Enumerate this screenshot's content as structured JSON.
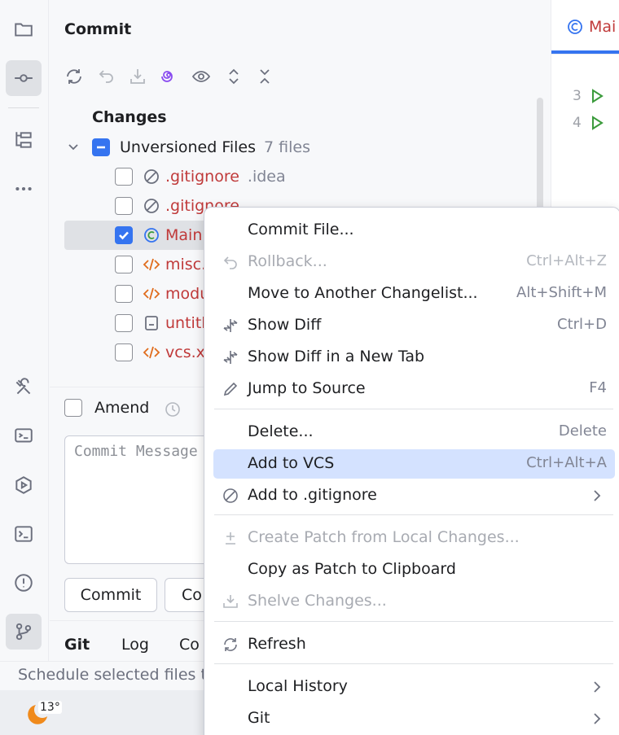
{
  "panel": {
    "title": "Commit",
    "changes_heading": "Changes",
    "group": {
      "label": "Unversioned Files",
      "count": "7 files"
    },
    "files": [
      {
        "name": ".gitignore",
        "note": ".idea",
        "icon": "ignored-icon",
        "checked": false
      },
      {
        "name": ".gitignore",
        "note": "",
        "icon": "ignored-icon",
        "checked": false
      },
      {
        "name": "Main.",
        "note": "",
        "icon": "java-class-icon",
        "checked": true
      },
      {
        "name": "misc.",
        "note": "",
        "icon": "xml-icon",
        "checked": false
      },
      {
        "name": "modu",
        "note": "",
        "icon": "xml-icon",
        "checked": false
      },
      {
        "name": "untitl",
        "note": "",
        "icon": "text-file-icon",
        "checked": false
      },
      {
        "name": "vcs.x",
        "note": "",
        "icon": "xml-icon",
        "checked": false
      }
    ],
    "amend_label": "Amend",
    "message_placeholder": "Commit Message",
    "commit_button": "Commit",
    "commit_push_button": "Co",
    "bottom_tabs": [
      "Git",
      "Log",
      "Co"
    ]
  },
  "editor": {
    "tab_label": "Mai",
    "line_numbers": [
      "3",
      "4"
    ]
  },
  "status_bar": {
    "text": "Schedule selected files to"
  },
  "taskbar": {
    "temperature": "13°"
  },
  "context_menu": {
    "items": [
      {
        "label": "Commit File...",
        "shortcut": "",
        "icon": "",
        "disabled": false
      },
      {
        "label": "Rollback...",
        "shortcut": "Ctrl+Alt+Z",
        "icon": "undo-icon",
        "disabled": true
      },
      {
        "label": "Move to Another Changelist...",
        "shortcut": "Alt+Shift+M",
        "icon": "",
        "disabled": false
      },
      {
        "label": "Show Diff",
        "shortcut": "Ctrl+D",
        "icon": "diff-icon",
        "disabled": false
      },
      {
        "label": "Show Diff in a New Tab",
        "shortcut": "",
        "icon": "diff-icon",
        "disabled": false
      },
      {
        "label": "Jump to Source",
        "shortcut": "F4",
        "icon": "pencil-icon",
        "disabled": false
      },
      {
        "label": "Delete...",
        "shortcut": "Delete",
        "icon": "",
        "disabled": false
      },
      {
        "label": "Add to VCS",
        "shortcut": "Ctrl+Alt+A",
        "icon": "",
        "disabled": false,
        "highlighted": true
      },
      {
        "label": "Add to .gitignore",
        "shortcut": "",
        "icon": "ignored-icon",
        "disabled": false,
        "submenu": true
      },
      {
        "label": "Create Patch from Local Changes...",
        "shortcut": "",
        "icon": "patch-icon",
        "disabled": true
      },
      {
        "label": "Copy as Patch to Clipboard",
        "shortcut": "",
        "icon": "",
        "disabled": false
      },
      {
        "label": "Shelve Changes...",
        "shortcut": "",
        "icon": "shelve-icon",
        "disabled": true
      },
      {
        "label": "Refresh",
        "shortcut": "",
        "icon": "refresh-icon",
        "disabled": false
      },
      {
        "label": "Local History",
        "shortcut": "",
        "icon": "",
        "disabled": false,
        "submenu": true
      },
      {
        "label": "Git",
        "shortcut": "",
        "icon": "",
        "disabled": false,
        "submenu": true
      }
    ]
  },
  "colors": {
    "accent": "#3574f0",
    "unversioned_file": "#c03a3a",
    "menu_highlight": "#d4e2ff",
    "run_icon": "#3b9b3c"
  }
}
